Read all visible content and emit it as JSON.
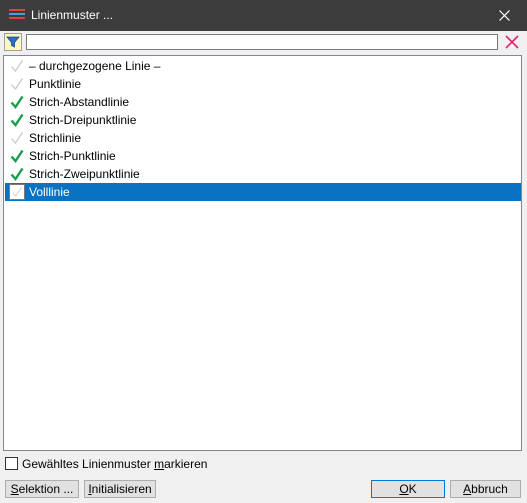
{
  "window": {
    "title": "Linienmuster ..."
  },
  "filter": {
    "value": ""
  },
  "list": {
    "items": [
      {
        "label": "– durchgezogene Linie –",
        "checked": false,
        "selected": false
      },
      {
        "label": "Punktlinie",
        "checked": false,
        "selected": false
      },
      {
        "label": "Strich-Abstandlinie",
        "checked": true,
        "selected": false
      },
      {
        "label": "Strich-Dreipunktlinie",
        "checked": true,
        "selected": false
      },
      {
        "label": "Strichlinie",
        "checked": false,
        "selected": false
      },
      {
        "label": "Strich-Punktlinie",
        "checked": true,
        "selected": false
      },
      {
        "label": "Strich-Zweipunktlinie",
        "checked": true,
        "selected": false
      },
      {
        "label": "Volllinie",
        "checked": false,
        "selected": true
      }
    ]
  },
  "options": {
    "mark_selected_pre": "Gewähltes Linienmuster ",
    "mark_selected_ul": "m",
    "mark_selected_post": "arkieren",
    "checked": false
  },
  "buttons": {
    "selection_ul": "S",
    "selection_rest": "elektion ...",
    "initialize_ul": "I",
    "initialize_rest": "nitialisieren",
    "ok_ul": "O",
    "ok_rest": "K",
    "cancel_ul": "A",
    "cancel_rest": "bbruch"
  },
  "colors": {
    "titlebar": "#3c3c3c",
    "selection": "#0a72c2",
    "check": "#1a9e4a"
  }
}
